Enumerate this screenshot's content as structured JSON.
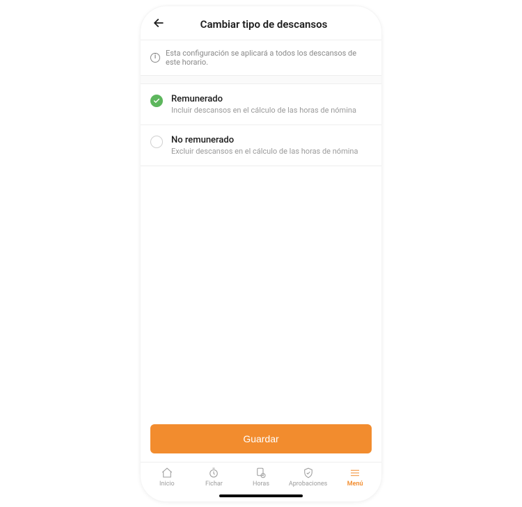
{
  "header": {
    "title": "Cambiar tipo de descansos"
  },
  "info": {
    "text": "Esta configuración se aplicará a todos los descansos de este horario."
  },
  "options": {
    "paid": {
      "title": "Remunerado",
      "desc": "Incluir descansos en el cálculo de las horas de nómina"
    },
    "unpaid": {
      "title": "No remunerado",
      "desc": "Excluir descansos en el cálculo de las horas de nómina"
    }
  },
  "buttons": {
    "save": "Guardar"
  },
  "tabs": {
    "home": "Inicio",
    "clock": "Fichar",
    "hours": "Horas",
    "approvals": "Aprobaciones",
    "menu": "Menú"
  },
  "colors": {
    "accent": "#f28c2e",
    "success": "#5db65d"
  }
}
